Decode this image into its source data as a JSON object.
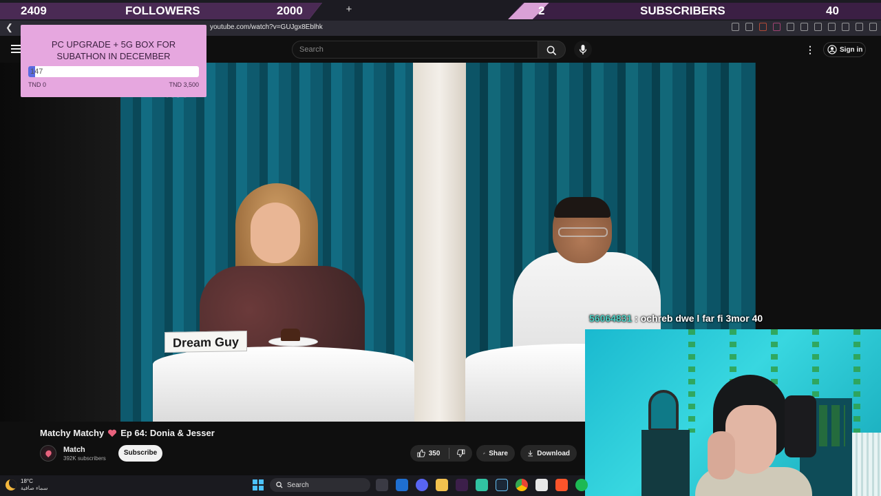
{
  "browser": {
    "url": "youtube.com/watch?v=GUJgx8Eblhk",
    "new_tab_symbol": "+"
  },
  "overlay": {
    "followers": {
      "current": "2409",
      "label": "FOLLOWERS",
      "goal": "2000",
      "progress": 1.0
    },
    "subscribers": {
      "current": "2",
      "label": "SUBSCRIBERS",
      "goal": "40",
      "progress": 0.05
    },
    "donation_goal": {
      "title_line1": "PC UPGRADE + 5G BOX FOR",
      "title_line2": "SUBATHON IN DECEMBER",
      "current_value": "147",
      "min_label": "TND 0",
      "max_label": "TND 3,500",
      "progress": 0.042
    },
    "chat": {
      "user": "56064831",
      "separator": " : ",
      "message": "ochreb dwe l far fi 3mor 40"
    }
  },
  "youtube": {
    "search_placeholder": "Search",
    "sign_in_label": "Sign in",
    "video": {
      "logo_text": "match",
      "name_card": "Dream Guy",
      "title_part1": "Matchy Matchy",
      "title_part2": "Ep 64: Donia & Jesser"
    },
    "channel": {
      "name": "Match",
      "subscribers": "392K subscribers",
      "subscribe_label": "Subscribe"
    },
    "actions": {
      "likes": "350",
      "share_label": "Share",
      "download_label": "Download"
    }
  },
  "taskbar": {
    "temperature": "18°C",
    "condition": "سماء صافية",
    "search_label": "Search"
  },
  "colors": {
    "overlay_pink": "#e6a7df",
    "overlay_dark": "#3b1f44",
    "chat_user": "#4fd1c5",
    "donation_fill": "#5b6ae0"
  }
}
